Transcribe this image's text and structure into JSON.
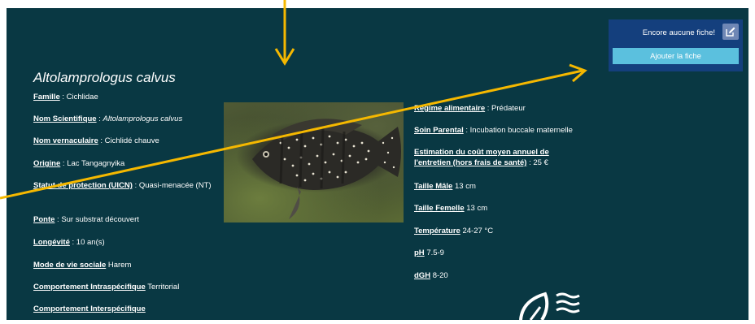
{
  "species": {
    "title": "Altolamprologus calvus"
  },
  "fields_left": [
    {
      "label": "Famille",
      "sep": " : ",
      "value": "Cichlidae"
    },
    {
      "label": "Nom Scientifique",
      "sep": " : ",
      "value": "Altolamprologus calvus"
    },
    {
      "label": "Nom vernaculaire",
      "sep": " : ",
      "value": "Cichlidé chauve"
    },
    {
      "label": "Origine",
      "sep": " : ",
      "value": "Lac Tangagnyika"
    },
    {
      "label": "Statut de protection (UICN)",
      "sep": " : ",
      "value": "Quasi-menacée (NT)"
    },
    {
      "label": "Ponte",
      "sep": " : ",
      "value": "Sur substrat découvert"
    },
    {
      "label": "Longévité",
      "sep": " : ",
      "value": "10 an(s)"
    },
    {
      "label": "Mode de vie sociale",
      "sep": " ",
      "value": "Harem"
    },
    {
      "label": "Comportement Intraspécifique",
      "sep": " ",
      "value": "Territorial"
    },
    {
      "label": "Comportement Interspécifique",
      "sep": "",
      "value": ""
    }
  ],
  "fields_right": [
    {
      "label": "Régime alimentaire",
      "sep": " : ",
      "value": "Prédateur"
    },
    {
      "label": "Soin Parental",
      "sep": " : ",
      "value": "Incubation buccale maternelle"
    },
    {
      "label": "Estimation du coût moyen annuel de l'entretien (hors frais de santé)",
      "sep": " : ",
      "value": "25 €"
    },
    {
      "label": "Taille Mâle",
      "sep": " ",
      "value": "13 cm"
    },
    {
      "label": "Taille Femelle",
      "sep": " ",
      "value": "13 cm"
    },
    {
      "label": "Température",
      "sep": " ",
      "value": "24-27 °C"
    },
    {
      "label": "pH",
      "sep": " ",
      "value": "7.5-9"
    },
    {
      "label": "dGH",
      "sep": " ",
      "value": "8-20"
    }
  ],
  "card": {
    "status": "Encore aucune fiche!",
    "add_button": "Ajouter la fiche"
  },
  "colors": {
    "background": "#093843",
    "card": "#143f7d",
    "button": "#5bc0de",
    "annotation_arrow": "#f5b800"
  },
  "icons": [
    "edit-icon",
    "fish-water-logo-icon"
  ]
}
